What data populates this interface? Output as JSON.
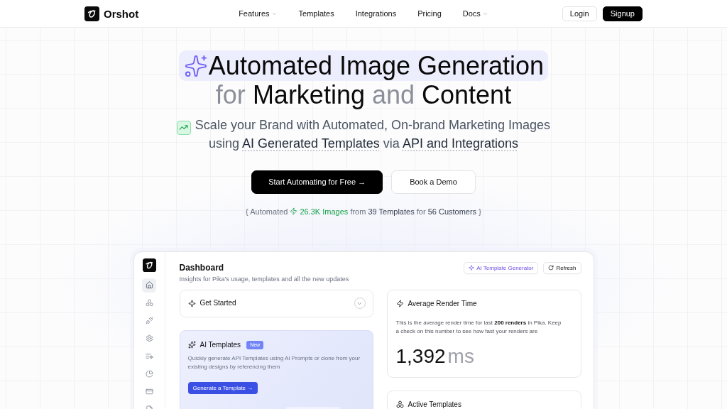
{
  "nav": {
    "brand": "Orshot",
    "links": [
      {
        "label": "Features",
        "has_menu": true
      },
      {
        "label": "Templates",
        "has_menu": false
      },
      {
        "label": "Integrations",
        "has_menu": false
      },
      {
        "label": "Pricing",
        "has_menu": false
      },
      {
        "label": "Docs",
        "has_menu": true
      }
    ],
    "buttons": [
      {
        "label": "Login",
        "kind": "secondary"
      },
      {
        "label": "Signup",
        "kind": "primary"
      }
    ]
  },
  "hero": {
    "headline": "Automated Image Generation",
    "tagline": [
      {
        "text": "for",
        "kind": "muted"
      },
      {
        "text": "Marketing",
        "kind": "strong"
      },
      {
        "text": "and",
        "kind": "muted"
      },
      {
        "text": "Content",
        "kind": "strong"
      }
    ],
    "subtitle": {
      "lines": [
        [
          {
            "text": "Scale your Brand with Automated, On-brand Marketing Images",
            "kind": "plain"
          }
        ],
        [
          {
            "text": "using",
            "kind": "plain"
          },
          {
            "text": "AI Generated Templates",
            "kind": "emphasis"
          },
          {
            "text": "via",
            "kind": "plain"
          },
          {
            "text": "API and Integrations",
            "kind": "emphasis"
          }
        ]
      ]
    },
    "buttons": [
      {
        "label": "Start Automating for Free →",
        "kind": "primary"
      },
      {
        "label": "Book a Demo",
        "kind": "secondary"
      }
    ],
    "stats": {
      "lead": "{ Automated",
      "segments": [
        {
          "text": "26.3K Images",
          "kind": "accent"
        },
        {
          "text": "from",
          "kind": "muted"
        },
        {
          "text": "39 Templates",
          "kind": "strong"
        },
        {
          "text": "for",
          "kind": "muted"
        },
        {
          "text": "56 Customers",
          "kind": "strong"
        },
        {
          "text": "}",
          "kind": "muted"
        }
      ]
    }
  },
  "dashboard": {
    "sidebar": {
      "items": [
        {
          "selected": true
        },
        {
          "selected": false
        },
        {
          "selected": false
        },
        {
          "selected": false
        },
        {
          "selected": false
        },
        {
          "selected": false
        },
        {
          "selected": false
        },
        {
          "selected": false
        }
      ]
    },
    "title": "Dashboard",
    "subtitle": "Insights for Pika's usage, templates and all the new updates",
    "actions": [
      {
        "label": "AI Template Generator",
        "kind": "ai"
      },
      {
        "label": "Refresh",
        "kind": "refresh"
      }
    ],
    "get_started": {
      "title": "Get Started",
      "expanded": false
    },
    "ai_templates": {
      "title": "AI Templates",
      "badge": "New",
      "description": "Quickly generate API Templates using AI Prompts or clone from your existing designs by referencing them",
      "button": "Generate a Template →"
    },
    "render_time": {
      "title": "Average Render Time",
      "description": "This is the average render time for last **200 renders** in Pika. Keep a check on this number to see how fast your renders are",
      "value": "1,392",
      "unit": "ms"
    },
    "active_templates": {
      "title": "Active Templates"
    }
  }
}
